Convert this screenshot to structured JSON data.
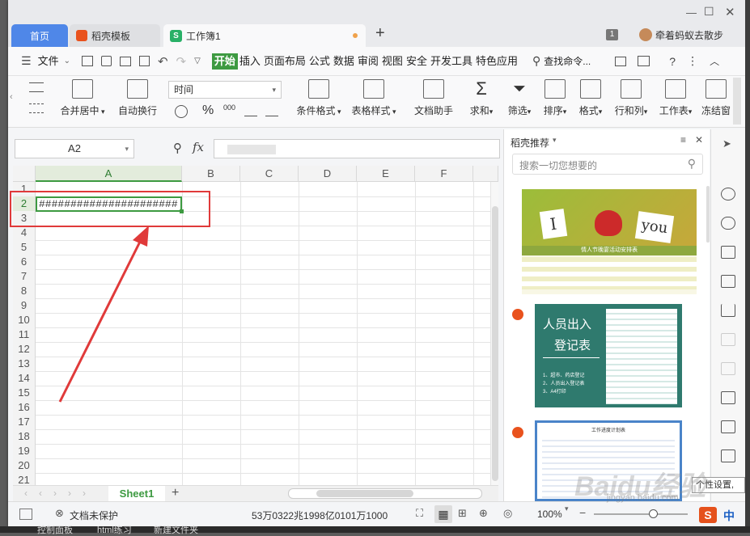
{
  "tabs": {
    "home": "首页",
    "daoke": "稻壳模板",
    "workbook": "工作簿1",
    "badge": "1",
    "user": "牵着蚂蚁去散步"
  },
  "menu": {
    "file": "文件",
    "items": [
      "开始",
      "插入",
      "页面布局",
      "公式",
      "数据",
      "审阅",
      "视图",
      "安全",
      "开发工具",
      "特色应用"
    ],
    "search": "查找命令..."
  },
  "ribbon": {
    "merge": "合并居中",
    "wrap": "自动换行",
    "format_select": "时间",
    "percent": "%",
    "thousand": "000",
    "cond_format": "条件格式",
    "table_style": "表格样式",
    "doc_helper": "文档助手",
    "sum": "求和",
    "filter": "筛选",
    "sort": "排序",
    "format": "格式",
    "rowcol": "行和列",
    "worksheet": "工作表",
    "freeze": "冻结窗"
  },
  "formula": {
    "cell_ref": "A2",
    "fx": "fx"
  },
  "grid": {
    "columns": [
      "A",
      "B",
      "C",
      "D",
      "E",
      "F"
    ],
    "rows": [
      "1",
      "2",
      "3",
      "4",
      "5",
      "6",
      "7",
      "8",
      "9",
      "10",
      "11",
      "12",
      "13",
      "14",
      "15",
      "16",
      "17",
      "18",
      "19",
      "20",
      "21"
    ],
    "a2_value": "######################"
  },
  "sheet": {
    "tab": "Sheet1"
  },
  "panel": {
    "title": "稻壳推荐",
    "search_placeholder": "搜索一切您想要的",
    "card1_line1": "I",
    "card1_line2": "you",
    "card1_caption": "情人节晚宴活动安排表",
    "card2_title1": "人员出入",
    "card2_title2": "登记表",
    "card2_list": [
      "1、超市、药店登记",
      "2、人员出入登记表",
      "3、A4打印"
    ],
    "card3_title": "工作进度计划表"
  },
  "status": {
    "protect": "文档未保护",
    "value": "53万0322兆1998亿0101万1000",
    "zoom": "100%",
    "tooltip": "个性设置,",
    "ime": "中"
  },
  "taskbar": {
    "items": [
      "控制面板",
      "html练习",
      "新建文件夹"
    ]
  },
  "watermark": "Baidu经验",
  "watermark_sub": "jingyan.baidu.com",
  "colors": {
    "accent": "#3d9a41",
    "home_tab": "#4f87e8",
    "red_box": "#e03a3a"
  }
}
